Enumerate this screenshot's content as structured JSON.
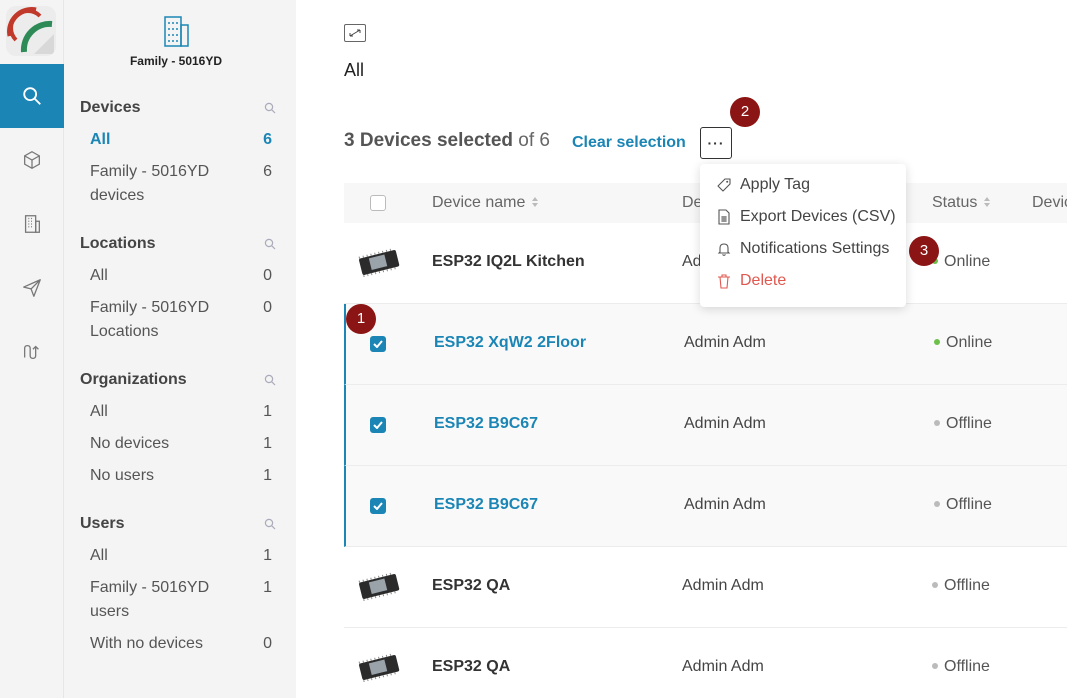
{
  "sidebar": {
    "org_name": "Family - 5016YD",
    "sections": [
      {
        "title": "Devices",
        "items": [
          {
            "label": "All",
            "count": "6"
          },
          {
            "label": "Family - 5016YD devices",
            "count": "6"
          }
        ]
      },
      {
        "title": "Locations",
        "items": [
          {
            "label": "All",
            "count": "0"
          },
          {
            "label": "Family - 5016YD Locations",
            "count": "0"
          }
        ]
      },
      {
        "title": "Organizations",
        "items": [
          {
            "label": "All",
            "count": "1"
          },
          {
            "label": "No devices",
            "count": "1"
          },
          {
            "label": "No users",
            "count": "1"
          }
        ]
      },
      {
        "title": "Users",
        "items": [
          {
            "label": "All",
            "count": "1"
          },
          {
            "label": "Family - 5016YD users",
            "count": "1"
          },
          {
            "label": "With no devices",
            "count": "0"
          }
        ]
      }
    ]
  },
  "main": {
    "title": "All",
    "selection": {
      "count_text": "3 Devices selected",
      "of_text": "of 6",
      "clear_label": "Clear selection",
      "more_label": "···"
    },
    "columns": {
      "name": "Device name",
      "owner": "De",
      "status": "Status",
      "extra": "Devic"
    },
    "rows": [
      {
        "name": "ESP32 IQ2L Kitchen",
        "owner": "Adm",
        "status": "Online"
      },
      {
        "name": "ESP32 XqW2 2Floor",
        "owner": "Admin Adm",
        "status": "Online"
      },
      {
        "name": "ESP32 B9C67",
        "owner": "Admin Adm",
        "status": "Offline"
      },
      {
        "name": "ESP32 B9C67",
        "owner": "Admin Adm",
        "status": "Offline"
      },
      {
        "name": "ESP32 QA",
        "owner": "Admin Adm",
        "status": "Offline"
      },
      {
        "name": "ESP32 QA",
        "owner": "Admin Adm",
        "status": "Offline"
      }
    ],
    "menu": {
      "apply_tag": "Apply Tag",
      "export": "Export Devices (CSV)",
      "notifications": "Notifications Settings",
      "delete": "Delete"
    }
  },
  "callouts": [
    "1",
    "2",
    "3"
  ],
  "colors": {
    "accent": "#1b86b5",
    "online": "#6bc04b",
    "danger": "#e0584f",
    "callout": "#8b1414"
  },
  "icons": [
    "logo",
    "search-icon",
    "cube-icon",
    "building-icon",
    "send-icon",
    "flow-icon",
    "expand-icon",
    "tag-icon",
    "csv-icon",
    "bell-icon",
    "trash-icon"
  ]
}
